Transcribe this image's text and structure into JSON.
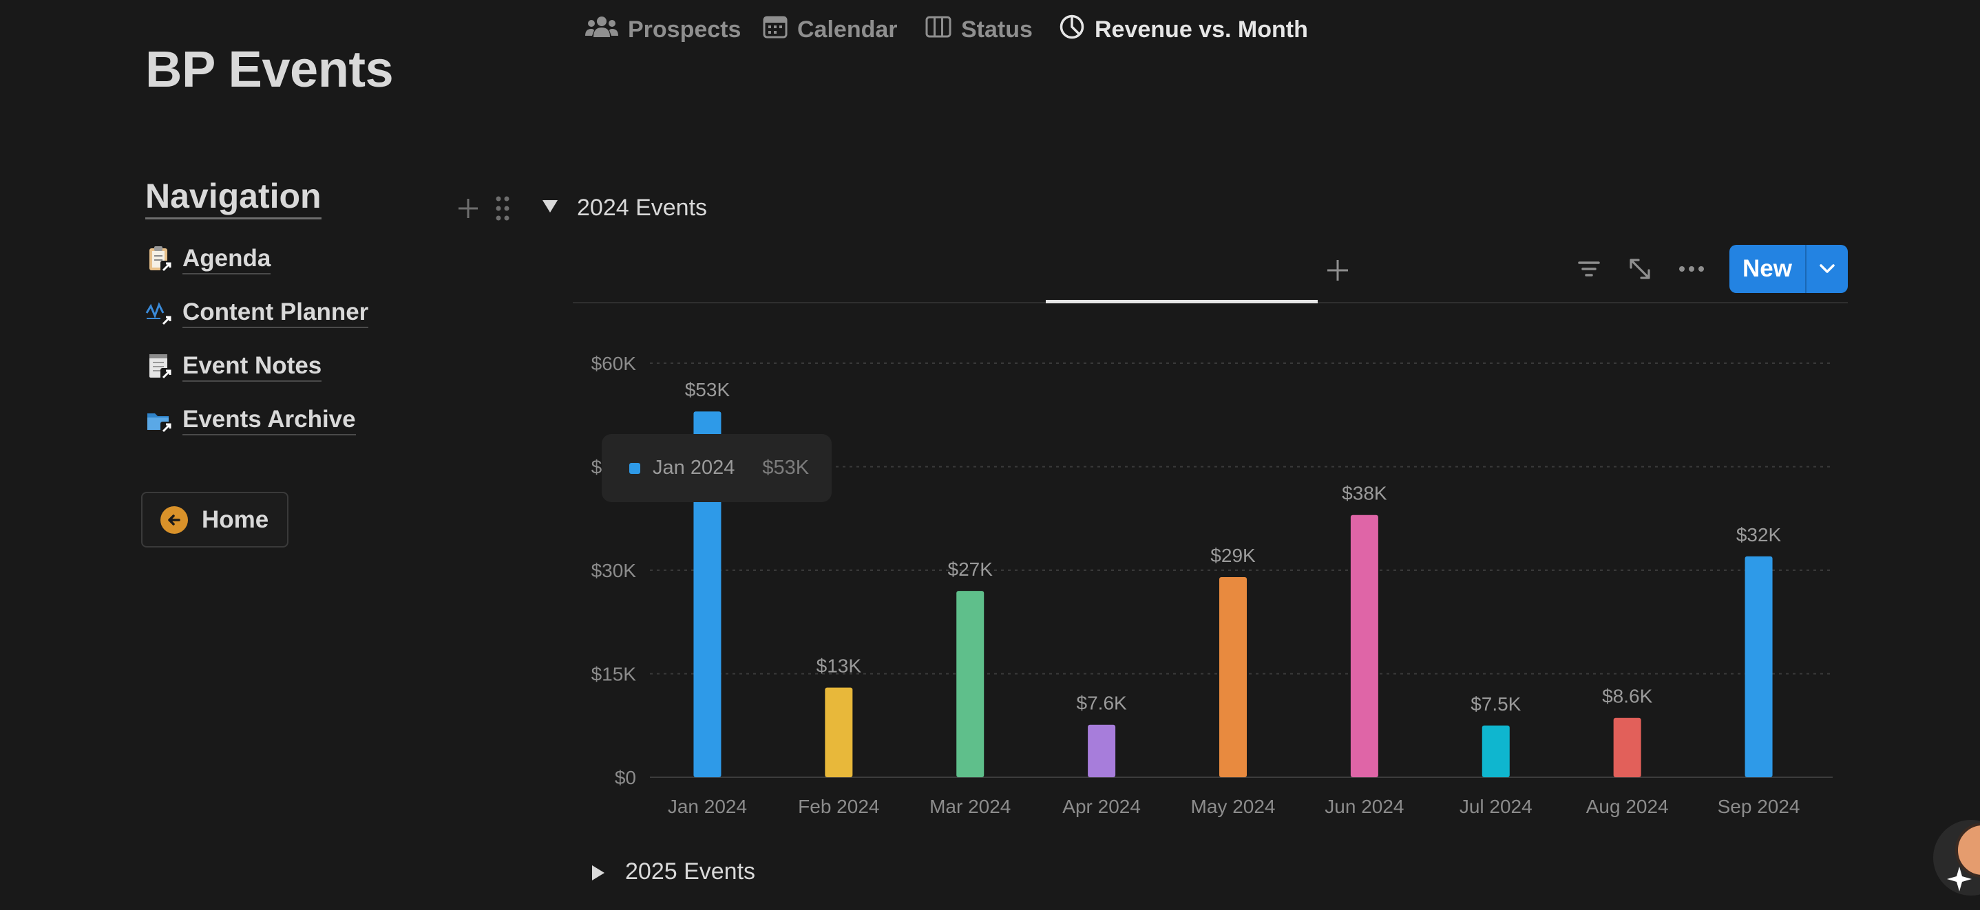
{
  "page": {
    "title": "BP Events"
  },
  "navigation": {
    "heading": "Navigation",
    "items": [
      {
        "label": "Agenda",
        "icon": "clipboard-link-icon"
      },
      {
        "label": "Content Planner",
        "icon": "chart-link-icon"
      },
      {
        "label": "Event Notes",
        "icon": "notepad-link-icon"
      },
      {
        "label": "Events Archive",
        "icon": "folder-link-icon"
      }
    ],
    "home_label": "Home"
  },
  "sections": {
    "first_title": "2024 Events",
    "second_title": "2025 Events"
  },
  "tabs": [
    {
      "label": "Prospects",
      "icon": "people-icon"
    },
    {
      "label": "Calendar",
      "icon": "calendar-icon"
    },
    {
      "label": "Status",
      "icon": "board-icon"
    },
    {
      "label": "Revenue vs. Month",
      "icon": "pie-chart-icon",
      "active": true
    }
  ],
  "toolbar": {
    "new_label": "New"
  },
  "tooltip": {
    "label": "Jan 2024",
    "value": "$53K"
  },
  "chart_data": {
    "type": "bar",
    "categories": [
      "Jan 2024",
      "Feb 2024",
      "Mar 2024",
      "Apr 2024",
      "May 2024",
      "Jun 2024",
      "Jul 2024",
      "Aug 2024",
      "Sep 2024"
    ],
    "values": [
      53000,
      13000,
      27000,
      7600,
      29000,
      38000,
      7500,
      8600,
      32000
    ],
    "labels": [
      "$53K",
      "$13K",
      "$27K",
      "$7.6K",
      "$29K",
      "$38K",
      "$7.5K",
      "$8.6K",
      "$32K"
    ],
    "colors": [
      "#2e9ae8",
      "#e8b83a",
      "#5fbf8b",
      "#a77ddb",
      "#e88a3f",
      "#df65a7",
      "#0fb6cf",
      "#e2605a",
      "#2e9ae8"
    ],
    "yticks": [
      0,
      15000,
      30000,
      45000,
      60000
    ],
    "ytick_labels": [
      "$0",
      "$15K",
      "$30K",
      "$45K",
      "$60K"
    ],
    "ylim": [
      0,
      60000
    ],
    "grid": true
  }
}
